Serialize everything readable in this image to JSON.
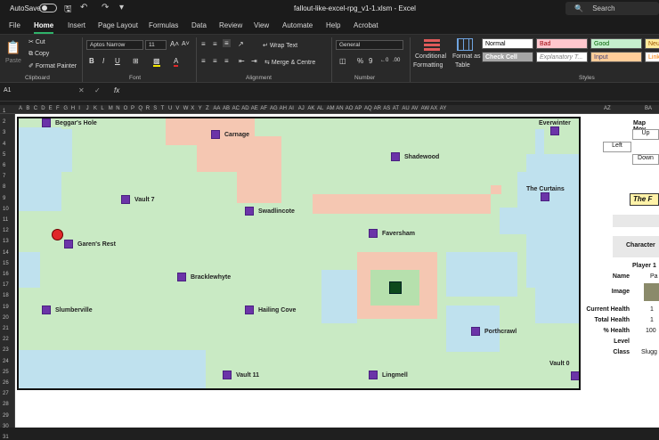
{
  "titlebar": {
    "autosave": "AutoSave",
    "filename": "fallout-like-excel-rpg_v1-1.xlsm - Excel",
    "search": "Search"
  },
  "tabs": [
    "File",
    "Home",
    "Insert",
    "Page Layout",
    "Formulas",
    "Data",
    "Review",
    "View",
    "Automate",
    "Help",
    "Acrobat"
  ],
  "ribbon": {
    "cut": "Cut",
    "copy": "Copy",
    "format_painter": "Format Painter",
    "paste": "Paste",
    "clipboard": "Clipboard",
    "font_name": "Aptos Narrow",
    "font_size": "11",
    "font": "Font",
    "wrap_text": "Wrap Text",
    "merge_center": "Merge & Centre",
    "alignment": "Alignment",
    "number_format": "General",
    "number": "Number",
    "conditional": "Conditional",
    "formatting": "Formatting",
    "format_as": "Format as",
    "table": "Table",
    "styles": "Styles",
    "style_normal": "Normal",
    "style_bad": "Bad",
    "style_good": "Good",
    "style_neutral": "Neu",
    "style_check": "Check Cell",
    "style_explanatory": "Explanatory T...",
    "style_input": "Input",
    "style_linked": "Link"
  },
  "formula_bar": {
    "cell_ref": "A1",
    "fx": "fx"
  },
  "columns": [
    "A",
    "B",
    "C",
    "D",
    "E",
    "F",
    "G",
    "H",
    "I",
    "J",
    "K",
    "L",
    "M",
    "N",
    "O",
    "P",
    "Q",
    "R",
    "S",
    "T",
    "U",
    "V",
    "W",
    "X",
    "Y",
    "Z",
    "AA",
    "AB",
    "AC",
    "AD",
    "AE",
    "AF",
    "AG",
    "AH",
    "AI",
    "AJ",
    "AK",
    "AL",
    "AM",
    "AN",
    "AO",
    "AP",
    "AQ",
    "AR",
    "AS",
    "AT",
    "AU",
    "AV",
    "AW",
    "AX",
    "AY",
    "AZ",
    "BA"
  ],
  "rows": [
    "1",
    "2",
    "3",
    "4",
    "5",
    "6",
    "7",
    "8",
    "9",
    "10",
    "11",
    "12",
    "13",
    "14",
    "15",
    "16",
    "17",
    "18",
    "19",
    "20",
    "21",
    "22",
    "23",
    "24",
    "25",
    "26",
    "27",
    "28",
    "29",
    "30",
    "31"
  ],
  "locations": [
    {
      "name": "Beggar's Hole"
    },
    {
      "name": "Carnage"
    },
    {
      "name": "Shadewood"
    },
    {
      "name": "Everwinter"
    },
    {
      "name": "Vault 7"
    },
    {
      "name": "Swadlincote"
    },
    {
      "name": "The Curtains"
    },
    {
      "name": "Faversham"
    },
    {
      "name": "Garen's Rest"
    },
    {
      "name": "Bracklewhyte"
    },
    {
      "name": "Slumberville"
    },
    {
      "name": "Hailing Cove"
    },
    {
      "name": "Porthcrawl"
    },
    {
      "name": "Vault 11"
    },
    {
      "name": "Lingmell"
    },
    {
      "name": "Vault 0"
    }
  ],
  "panel": {
    "map_move": "Map Mov",
    "up": "Up",
    "left": "Left",
    "down": "Down",
    "the_title": "The F",
    "character": "Character",
    "player": "Player 1",
    "labels": {
      "name": "Name",
      "image": "Image",
      "current_health": "Current Health",
      "total_health": "Total Health",
      "pct_health": "% Health",
      "level": "Level",
      "class": "Class"
    },
    "values": {
      "name": "Pa",
      "current_health": "1",
      "total_health": "1",
      "pct_health": "100",
      "class": "Slugg"
    }
  }
}
